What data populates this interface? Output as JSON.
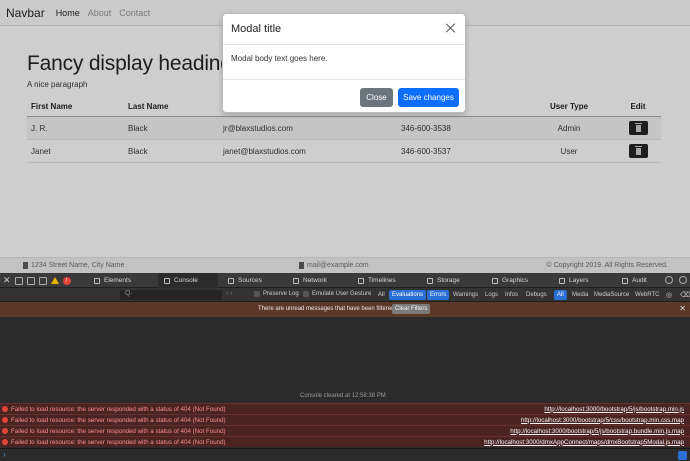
{
  "navbar": {
    "brand": "Navbar",
    "links": [
      "Home",
      "About",
      "Contact"
    ]
  },
  "main": {
    "heading": "Fancy display heading",
    "paragraph": "A nice paragraph"
  },
  "table": {
    "headers": [
      "First Name",
      "Last Name",
      "",
      "",
      "User Type",
      "Edit"
    ],
    "rows": [
      {
        "first": "J. R.",
        "last": "Black",
        "email": "jr@blaxstudios.com",
        "phone": "346-600-3538",
        "type": "Admin"
      },
      {
        "first": "Janet",
        "last": "Black",
        "email": "janet@blaxstudios.com",
        "phone": "346-600-3537",
        "type": "User"
      }
    ]
  },
  "modal": {
    "title": "Modal title",
    "body": "Modal body text goes here.",
    "close_label": "Close",
    "save_label": "Save changes"
  },
  "page_footer": {
    "address": "1234 Street Name, City Name",
    "email": "mail@example.com",
    "copyright": "© Copyright 2019. All Rights Reserved."
  },
  "devtools": {
    "tabs": [
      "Elements",
      "Console",
      "Sources",
      "Network",
      "Timelines",
      "Storage",
      "Graphics",
      "Layers",
      "Audit"
    ],
    "active_tab": "Console",
    "filter": {
      "preserve_log": "Preserve Log",
      "emulate_gesture": "Emulate User Gesture",
      "scope_all": "All",
      "scope_evaluations": "Evaluations",
      "levels": [
        "Errors",
        "Warnings",
        "Logs",
        "Infos",
        "Debugs"
      ],
      "types": [
        "All",
        "Media",
        "MediaSource",
        "WebRTC"
      ]
    },
    "banner": {
      "text": "There are unread messages that have been filtered",
      "button": "Clear Filters"
    },
    "cleared": "Console cleared at 12:58:38 PM",
    "errors": [
      {
        "message": "Failed to load resource: the server responded with a status of 404 (Not Found)",
        "url": "http://localhost:3000/bootstrap/5/js/bootstrap.min.js"
      },
      {
        "message": "Failed to load resource: the server responded with a status of 404 (Not Found)",
        "url": "http://localhost:3000/bootstrap/5/css/bootstrap.min.css.map"
      },
      {
        "message": "Failed to load resource: the server responded with a status of 404 (Not Found)",
        "url": "http://localhost:3000/bootstrap/5/js/bootstrap.bundle.min.js.map"
      },
      {
        "message": "Failed to load resource: the server responded with a status of 404 (Not Found)",
        "url": "http://localhost:3000/dmxAppConnect/maps/dmxBootstrap5Modal.js.map"
      }
    ]
  }
}
